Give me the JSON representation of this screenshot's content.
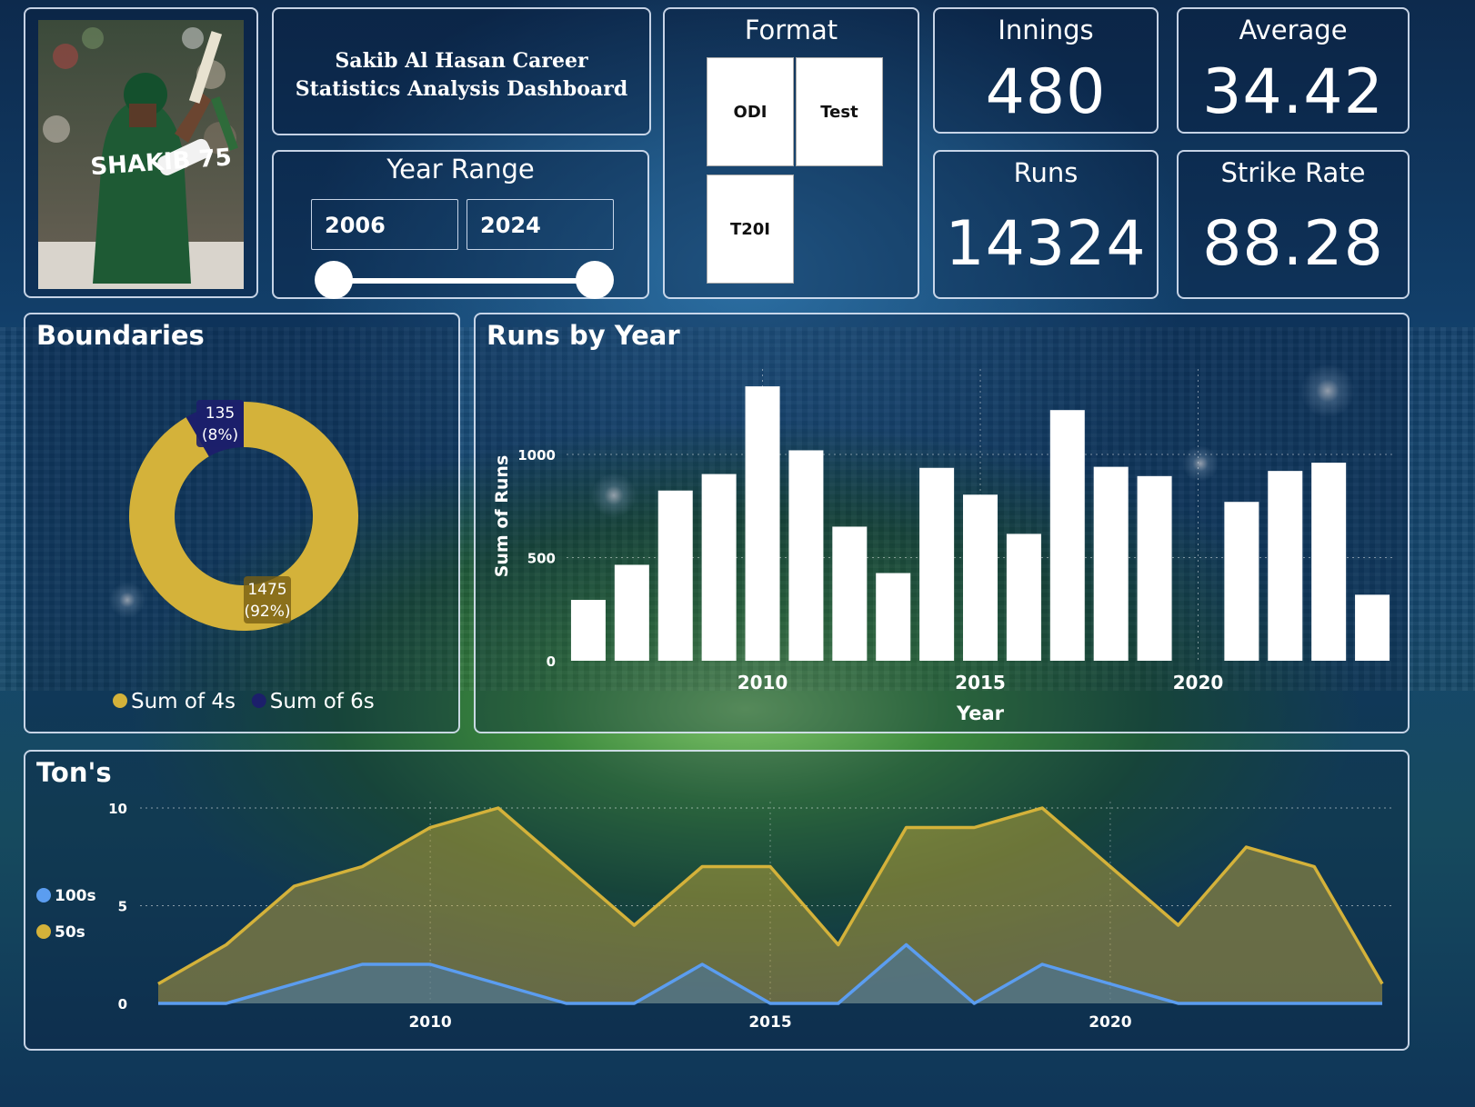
{
  "header": {
    "photo_caption": "SHAKIB 75",
    "title": "Sakib Al Hasan Career Statistics Analysis Dashboard"
  },
  "year_range": {
    "label": "Year Range",
    "start": "2006",
    "end": "2024"
  },
  "format": {
    "label": "Format",
    "options": [
      "ODI",
      "Test",
      "T20I"
    ]
  },
  "kpis": {
    "innings": {
      "label": "Innings",
      "value": "480"
    },
    "average": {
      "label": "Average",
      "value": "34.42"
    },
    "runs": {
      "label": "Runs",
      "value": "14324"
    },
    "strike_rate": {
      "label": "Strike Rate",
      "value": "88.28"
    }
  },
  "colors": {
    "fours": "#d4b23a",
    "sixes": "#1c1f6b",
    "hundreds": "#5b9df0",
    "fifties": "#d4b23a",
    "bars": "#ffffff"
  },
  "chart_data": [
    {
      "type": "pie",
      "title": "Boundaries",
      "donut": true,
      "slices": [
        {
          "name": "Sum of 4s",
          "value": 1475,
          "label": "1475",
          "pct": "(92%)"
        },
        {
          "name": "Sum of 6s",
          "value": 135,
          "label": "135",
          "pct": "(8%)"
        }
      ],
      "legend": "bottom"
    },
    {
      "type": "bar",
      "title": "Runs by Year",
      "xlabel": "Year",
      "ylabel": "Sum of Runs",
      "categories": [
        2006,
        2007,
        2008,
        2009,
        2010,
        2011,
        2012,
        2013,
        2014,
        2015,
        2016,
        2017,
        2018,
        2019,
        2021,
        2022,
        2023,
        2024
      ],
      "values": [
        295,
        465,
        825,
        905,
        1330,
        1020,
        650,
        425,
        935,
        805,
        615,
        1215,
        940,
        895,
        770,
        920,
        960,
        320
      ],
      "x_ticks": [
        "2010",
        "2015",
        "2020"
      ],
      "y_ticks": [
        "0",
        "500",
        "1000"
      ],
      "ylim": [
        0,
        1400
      ],
      "grid": true
    },
    {
      "type": "area",
      "title": "Ton's",
      "x": [
        2006,
        2007,
        2008,
        2009,
        2010,
        2011,
        2012,
        2013,
        2014,
        2015,
        2016,
        2017,
        2018,
        2019,
        2020,
        2021,
        2022,
        2023,
        2024
      ],
      "series": [
        {
          "name": "50s",
          "values": [
            1,
            3,
            6,
            7,
            9,
            10,
            7,
            4,
            7,
            7,
            3,
            9,
            9,
            10,
            7,
            4,
            8,
            7,
            1
          ]
        },
        {
          "name": "100s",
          "values": [
            0,
            0,
            1,
            2,
            2,
            1,
            0,
            0,
            2,
            0,
            0,
            3,
            0,
            2,
            1,
            0,
            0,
            0,
            0
          ]
        }
      ],
      "x_ticks": [
        "2010",
        "2015",
        "2020"
      ],
      "y_ticks": [
        "0",
        "5",
        "10"
      ],
      "ylim": [
        0,
        10
      ],
      "legend": "left",
      "grid": true
    }
  ]
}
